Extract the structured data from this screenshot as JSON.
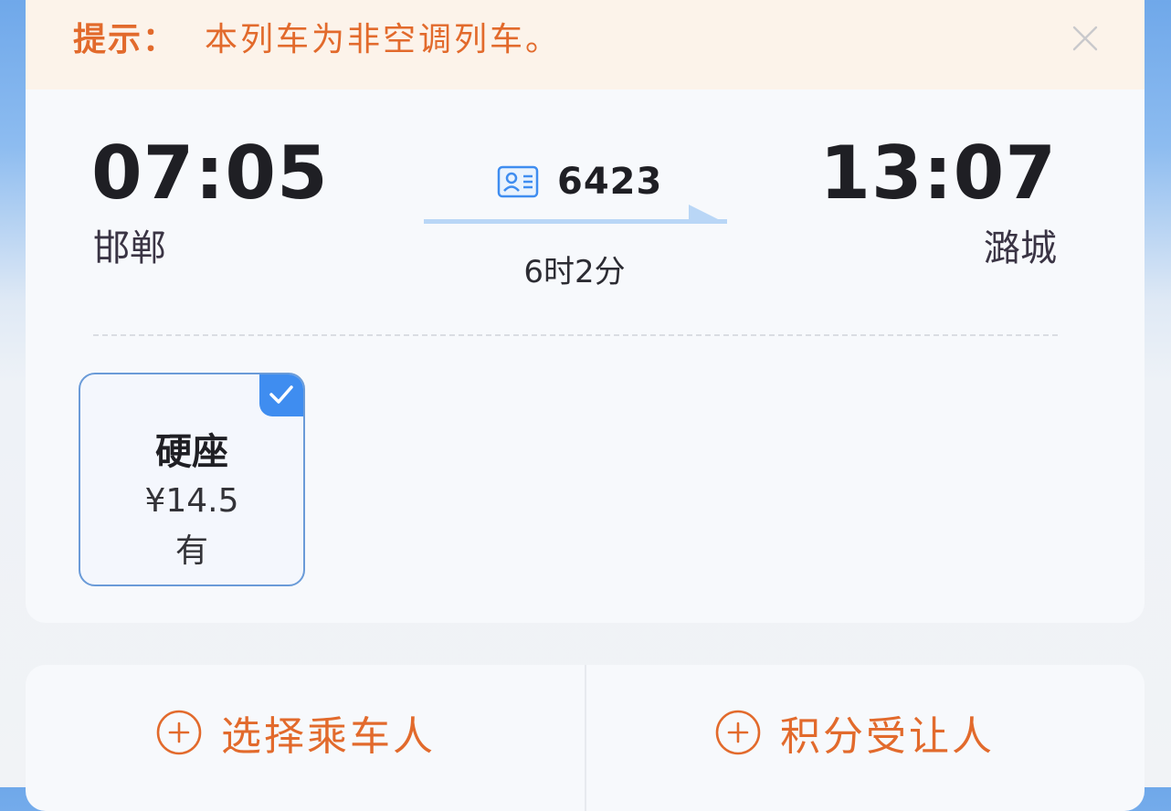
{
  "notice": {
    "label": "提示：",
    "text": "本列车为非空调列车。",
    "close_icon": "close-icon"
  },
  "trip": {
    "departure_time": "07:05",
    "departure_station": "邯郸",
    "arrival_time": "13:07",
    "arrival_station": "潞城",
    "train_number": "6423",
    "train_icon": "id-card-icon",
    "duration": "6时2分"
  },
  "seats": [
    {
      "type": "硬座",
      "price": "¥14.5",
      "availability": "有",
      "selected": true
    }
  ],
  "actions": {
    "select_passenger": "选择乘车人",
    "points_transferee": "积分受让人",
    "add_icon": "plus-circle-icon"
  },
  "colors": {
    "accent_orange": "#e26a2c",
    "accent_blue": "#3f8df0",
    "notice_bg": "#fcf3ea"
  }
}
